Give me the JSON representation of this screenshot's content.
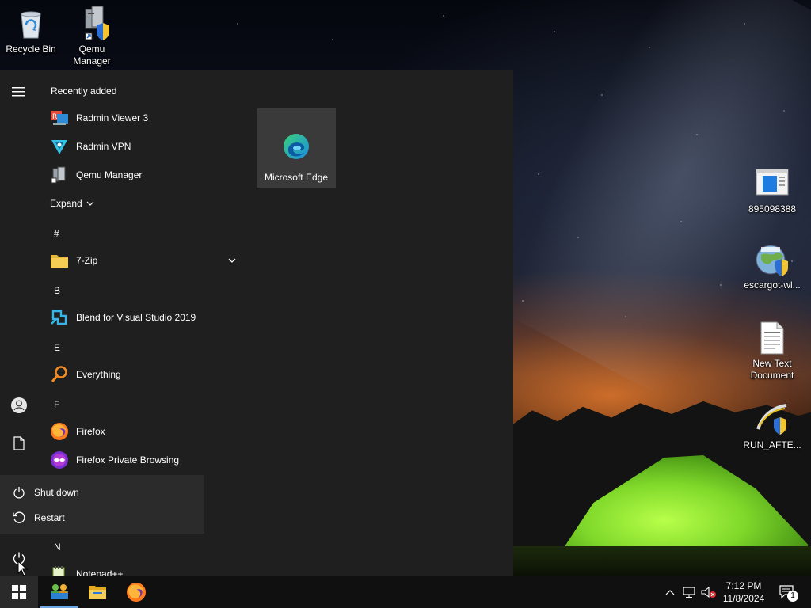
{
  "desktop": {
    "icons": [
      {
        "label": "Recycle Bin",
        "icon": "recycle-bin-icon"
      },
      {
        "label": "Qemu Manager",
        "icon": "qemu-manager-icon"
      },
      {
        "label": "895098388",
        "icon": "window-app-icon"
      },
      {
        "label": "escargot-wl...",
        "icon": "globe-shield-icon"
      },
      {
        "label": "New Text Document",
        "icon": "text-document-icon"
      },
      {
        "label": "RUN_AFTE...",
        "icon": "script-shield-icon"
      }
    ]
  },
  "start_menu": {
    "recently_added_title": "Recently added",
    "recent": [
      {
        "label": "Radmin Viewer 3",
        "icon": "radmin-viewer-icon"
      },
      {
        "label": "Radmin VPN",
        "icon": "radmin-vpn-icon"
      },
      {
        "label": "Qemu Manager",
        "icon": "qemu-manager-icon"
      }
    ],
    "expand_label": "Expand",
    "groups": [
      {
        "letter": "#",
        "items": [
          {
            "label": "7-Zip",
            "icon": "folder-icon",
            "expandable": true
          }
        ]
      },
      {
        "letter": "B",
        "items": [
          {
            "label": "Blend for Visual Studio 2019",
            "icon": "blend-icon"
          }
        ]
      },
      {
        "letter": "E",
        "items": [
          {
            "label": "Everything",
            "icon": "magnifier-icon"
          }
        ]
      },
      {
        "letter": "F",
        "items": [
          {
            "label": "Firefox",
            "icon": "firefox-icon"
          },
          {
            "label": "Firefox Private Browsing",
            "icon": "firefox-private-icon"
          }
        ]
      },
      {
        "letter": "N",
        "items": [
          {
            "label": "Notepad++",
            "icon": "notepad-plus-icon"
          }
        ]
      }
    ],
    "tiles": [
      {
        "label": "Microsoft Edge",
        "icon": "edge-icon"
      }
    ],
    "power_menu": {
      "shutdown_label": "Shut down",
      "restart_label": "Restart"
    }
  },
  "taskbar": {
    "pinned": [
      {
        "name": "start",
        "icon": "windows-logo-icon"
      },
      {
        "name": "radmin-vpn",
        "icon": "network-users-icon",
        "active": true
      },
      {
        "name": "file-explorer",
        "icon": "folder-icon"
      },
      {
        "name": "firefox",
        "icon": "firefox-icon"
      }
    ],
    "clock": {
      "time": "7:12 PM",
      "date": "11/8/2024"
    },
    "notification_count": "1"
  },
  "colors": {
    "menu_bg": "#1f1f1f",
    "power_popup_bg": "#2b2b2b",
    "tile_bg": "#3a3a3a",
    "taskbar_bg": "#101010",
    "accent": "#6fa6e6"
  }
}
